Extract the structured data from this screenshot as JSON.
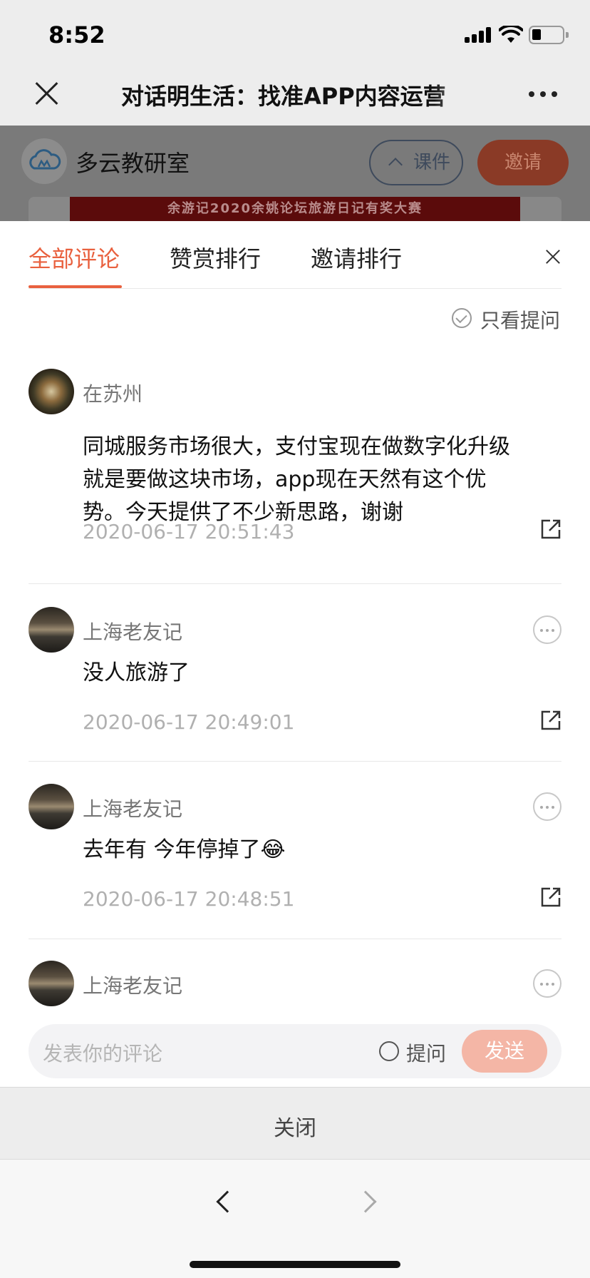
{
  "status_bar": {
    "time": "8:52"
  },
  "nav": {
    "title": "对话明生活：找准APP内容运营"
  },
  "background_page": {
    "channel_name": "多云教研室",
    "courseware_label": "课件",
    "invite_label": "邀请",
    "banner_text": "余游记2020余姚论坛旅游日记有奖大赛"
  },
  "sheet": {
    "tabs": [
      "全部评论",
      "赞赏排行",
      "邀请排行"
    ],
    "active_tab": 0,
    "filter_label": "只看提问",
    "comments": [
      {
        "author": "在苏州",
        "text": "同城服务市场很大，支付宝现在做数字化升级就是要做这块市场，app现在天然有这个优势。今天提供了不少新思路，谢谢",
        "time": "2020-06-17 20:51:43"
      },
      {
        "author": "上海老友记",
        "text": "没人旅游了",
        "time": "2020-06-17 20:49:01"
      },
      {
        "author": "上海老友记",
        "text": "去年有 今年停掉了😂",
        "time": "2020-06-17 20:48:51"
      },
      {
        "author": "上海老友记"
      }
    ],
    "input": {
      "placeholder": "发表你的评论",
      "question_label": "提问",
      "send_label": "发送"
    }
  },
  "close_bar": {
    "label": "关闭"
  },
  "colors": {
    "accent": "#e9613f",
    "send_button": "#f4b6a6",
    "timestamp": "#b0b0b0"
  },
  "icons": [
    "close-icon",
    "more-icon",
    "cloud-logo-icon",
    "chevron-up-icon",
    "check-circle-icon",
    "share-icon",
    "back-arrow-icon",
    "forward-arrow-icon"
  ]
}
